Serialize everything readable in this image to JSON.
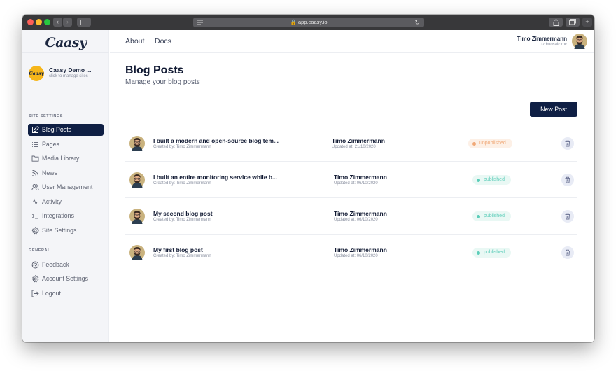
{
  "browser": {
    "url": "app.caasy.io",
    "colors": {
      "close": "#fe5f57",
      "minimize": "#febc2e",
      "zoom": "#28c840"
    }
  },
  "sidebar": {
    "logo": "Caasy",
    "site": {
      "avatar_text": "Caasy",
      "name": "Caasy Demo ...",
      "subtitle": "click to manage sites"
    },
    "site_settings_label": "SITE SETTINGS",
    "site_settings_items": [
      {
        "label": "Blog Posts",
        "icon": "edit-icon",
        "active": true
      },
      {
        "label": "Pages",
        "icon": "list-icon"
      },
      {
        "label": "Media Library",
        "icon": "folder-icon"
      },
      {
        "label": "News",
        "icon": "rss-icon"
      },
      {
        "label": "User Management",
        "icon": "users-icon"
      },
      {
        "label": "Activity",
        "icon": "activity-icon"
      },
      {
        "label": "Integrations",
        "icon": "terminal-icon"
      },
      {
        "label": "Site Settings",
        "icon": "gear-icon"
      }
    ],
    "general_label": "GENERAL",
    "general_items": [
      {
        "label": "Feedback",
        "icon": "aperture-icon"
      },
      {
        "label": "Account Settings",
        "icon": "gear-icon"
      },
      {
        "label": "Logout",
        "icon": "logout-icon"
      }
    ]
  },
  "topnav": {
    "links": [
      "About",
      "Docs"
    ],
    "user": {
      "name": "Timo Zimmermann",
      "handle": "tzdmosaic.mc"
    }
  },
  "main": {
    "title": "Blog Posts",
    "subtitle": "Manage your blog posts",
    "new_post_label": "New Post",
    "posts": [
      {
        "title": "I built a modern and open-source blog tem...",
        "created": "Created by: Timo Zimmermann",
        "author": "Timo Zimmermann",
        "updated": "Updated at: 21/10/2020",
        "status": "unpublished"
      },
      {
        "title": "I built an entire monitoring service while b...",
        "created": "Created by: Timo Zimmermann",
        "author": "Timo Zimmermann",
        "updated": "Updated at: 06/10/2020",
        "status": "published"
      },
      {
        "title": "My second blog post",
        "created": "Created by: Timo Zimmermann",
        "author": "Timo Zimmermann",
        "updated": "Updated at: 06/10/2020",
        "status": "published"
      },
      {
        "title": "My first blog post",
        "created": "Created by: Timo Zimmermann",
        "author": "Timo Zimmermann",
        "updated": "Updated at: 06/10/2020",
        "status": "published"
      }
    ]
  }
}
